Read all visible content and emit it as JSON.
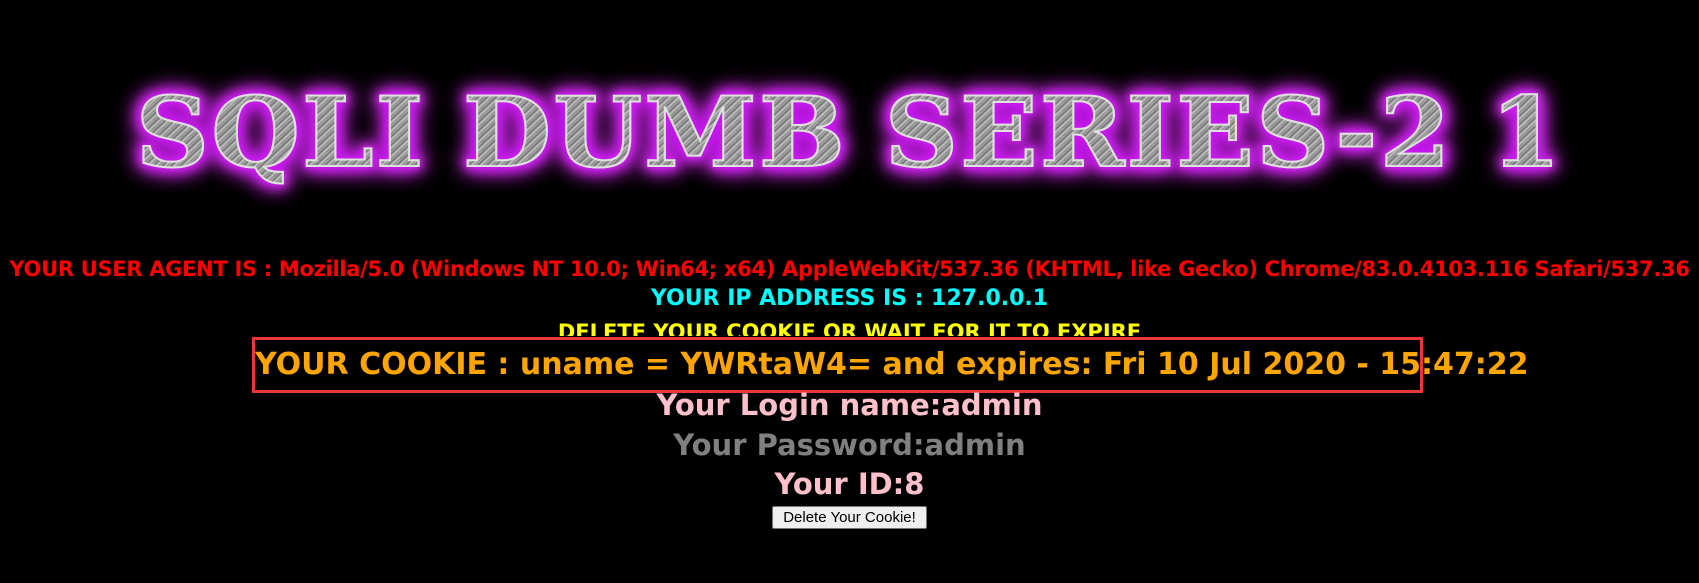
{
  "banner": {
    "title": "SQLI DUMB SERIES-2 1"
  },
  "info": {
    "user_agent": "YOUR USER AGENT IS : Mozilla/5.0 (Windows NT 10.0; Win64; x64) AppleWebKit/537.36 (KHTML, like Gecko) Chrome/83.0.4103.116 Safari/537.36",
    "ip_address": "YOUR IP ADDRESS IS : 127.0.0.1",
    "delete_message": "DELETE YOUR COOKIE OR WAIT FOR IT TO EXPIRE",
    "cookie": "YOUR COOKIE : uname = YWRtaW4= and expires: Fri 10 Jul 2020 - 15:47:22",
    "login_name": "Your Login name:admin",
    "password": "Your Password:admin",
    "id": "Your ID:8"
  },
  "actions": {
    "delete_cookie_label": "Delete Your Cookie!"
  },
  "colors": {
    "background": "#000000",
    "user_agent": "#ff0000",
    "ip_address": "#00ffff",
    "delete_message": "#ffff00",
    "cookie": "#ffa500",
    "highlight_border": "#e8383a",
    "login_name": "#ffc0cb",
    "password": "#808080",
    "id": "#ffc0cb"
  }
}
